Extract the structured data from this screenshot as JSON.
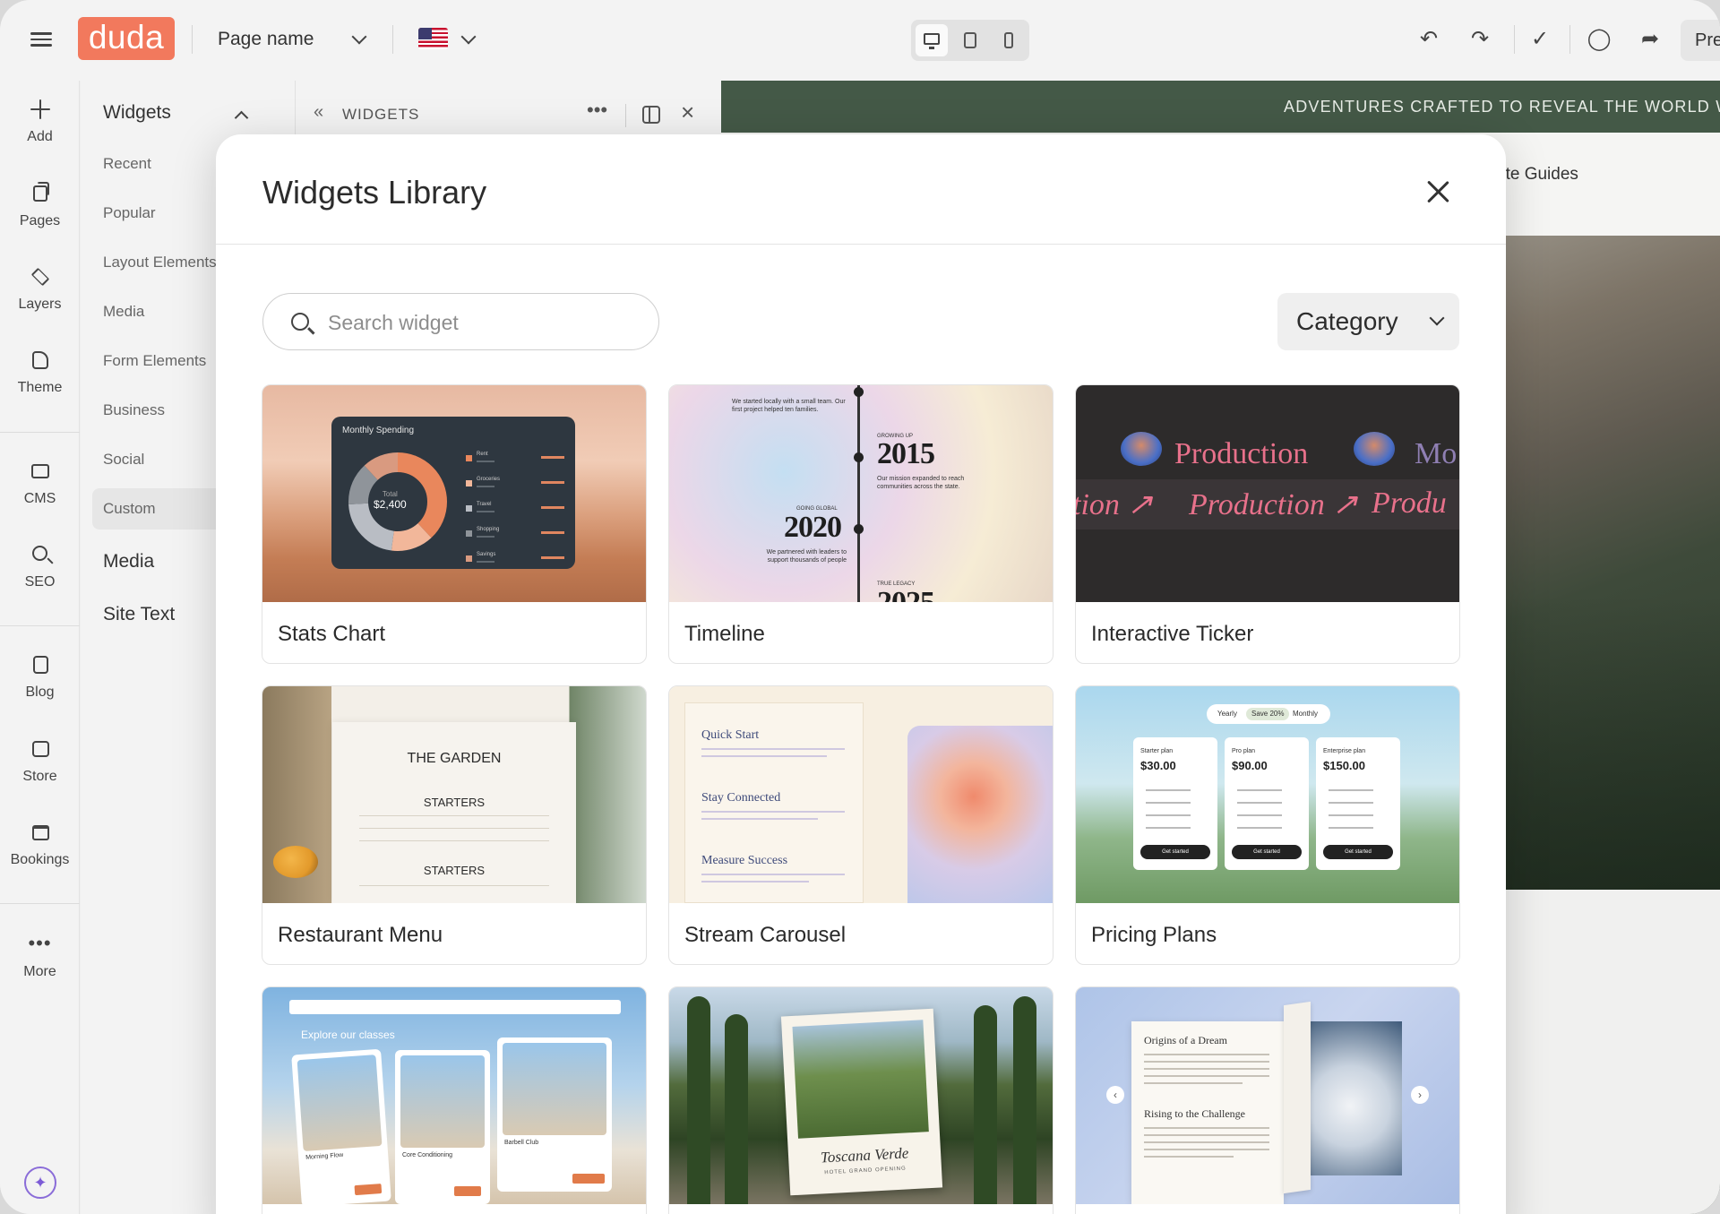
{
  "app": {
    "logo": "duda",
    "page_name": "Page name",
    "preview_label": "Pre"
  },
  "rail": {
    "items": [
      {
        "label": "Add",
        "icon": "plus-icon"
      },
      {
        "label": "Pages",
        "icon": "pages-icon"
      },
      {
        "label": "Layers",
        "icon": "layers-icon"
      },
      {
        "label": "Theme",
        "icon": "theme-icon"
      },
      {
        "label": "CMS",
        "icon": "folder-icon"
      },
      {
        "label": "SEO",
        "icon": "seo-icon"
      },
      {
        "label": "Blog",
        "icon": "blog-icon"
      },
      {
        "label": "Store",
        "icon": "store-icon"
      },
      {
        "label": "Bookings",
        "icon": "bookings-icon"
      },
      {
        "label": "More",
        "icon": "more-dots-icon"
      }
    ]
  },
  "widgets_panel": {
    "title": "Widgets",
    "categories": [
      "Recent",
      "Popular",
      "Layout Elements",
      "Media",
      "Form Elements",
      "Business",
      "Social",
      "Custom"
    ],
    "sections": [
      "Media",
      "Site Text"
    ],
    "header_title": "WIDGETS"
  },
  "site": {
    "banner": "ADVENTURES CRAFTED TO REVEAL THE WORLD WITH",
    "nav_text": "ate Guides"
  },
  "modal": {
    "title": "Widgets Library",
    "search_placeholder": "Search widget",
    "category_label": "Category",
    "cards": [
      {
        "label": "Stats Chart"
      },
      {
        "label": "Timeline"
      },
      {
        "label": "Interactive Ticker"
      },
      {
        "label": "Restaurant Menu"
      },
      {
        "label": "Stream Carousel"
      },
      {
        "label": "Pricing Plans"
      }
    ]
  },
  "thumbs": {
    "stats": {
      "title": "Monthly Spending",
      "subtitle": "Total",
      "total": "$2,400",
      "legend": [
        "Rent",
        "Groceries",
        "Travel",
        "Shopping",
        "Savings"
      ],
      "slices": [
        {
          "value": 38,
          "color": "#e9875c"
        },
        {
          "value": 14,
          "color": "#f2b79a"
        },
        {
          "value": 22,
          "color": "#b9bdc4"
        },
        {
          "value": 14,
          "color": "#8f949a"
        },
        {
          "value": 12,
          "color": "#d99a80"
        }
      ]
    },
    "timeline": {
      "years": [
        "2015",
        "2020",
        "2025"
      ],
      "top_text": "We started locally with a small team. Our first project helped ten families.",
      "growing": "GROWING UP",
      "mission": "Our mission expanded to reach communities across the state.",
      "global": "GOING GLOBAL",
      "partnered": "We partnered with leaders to support thousands of people",
      "legacy": "TRUE LEGACY"
    },
    "ticker": {
      "word": "Production",
      "word_partial": "Mo",
      "row2_a": "tion ↗",
      "row2_b": "Production ↗",
      "row2_c": "Produ"
    },
    "restaurant": {
      "title": "THE GARDEN",
      "section1": "STARTERS",
      "section2": "STARTERS"
    },
    "stream": {
      "items": [
        "Quick Start",
        "Stay Connected",
        "Measure Success"
      ]
    },
    "pricing": {
      "toggle_yearly": "Yearly",
      "toggle_save": "Save 20%",
      "toggle_monthly": "Monthly",
      "plans": [
        {
          "name": "Starter plan",
          "price": "$30.00",
          "cta": "Get started"
        },
        {
          "name": "Pro plan",
          "price": "$90.00",
          "cta": "Get started"
        },
        {
          "name": "Enterprise plan",
          "price": "$150.00",
          "cta": "Get started"
        }
      ]
    },
    "yoga": {
      "title": "Explore our classes",
      "classes": [
        "Morning Flow",
        "Core Conditioning",
        "Barbell Club"
      ]
    },
    "road": {
      "caption": "Toscana Verde",
      "sub": "HOTEL GRAND OPENING"
    },
    "dream": {
      "heading1": "Origins of a Dream",
      "heading2": "Rising to the Challenge"
    }
  }
}
